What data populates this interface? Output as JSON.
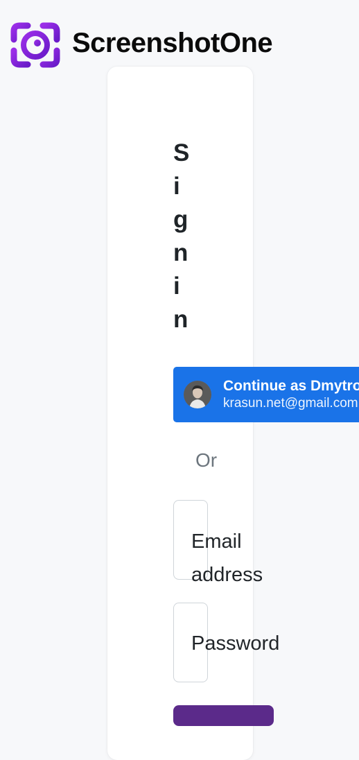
{
  "brand": {
    "name": "ScreenshotOne",
    "logo_icon": "camera-focus-icon",
    "accent_color": "#7e22ce"
  },
  "signin": {
    "title": "Sign in",
    "google": {
      "continue_label": "Continue as Dmytro",
      "email": "krasun.net@gmail.com",
      "avatar_icon": "user-avatar",
      "button_color": "#1a73e8"
    },
    "divider_text": "Or",
    "email_label": "Email address",
    "password_label": "Password",
    "submit_color": "#5b2a8a"
  }
}
